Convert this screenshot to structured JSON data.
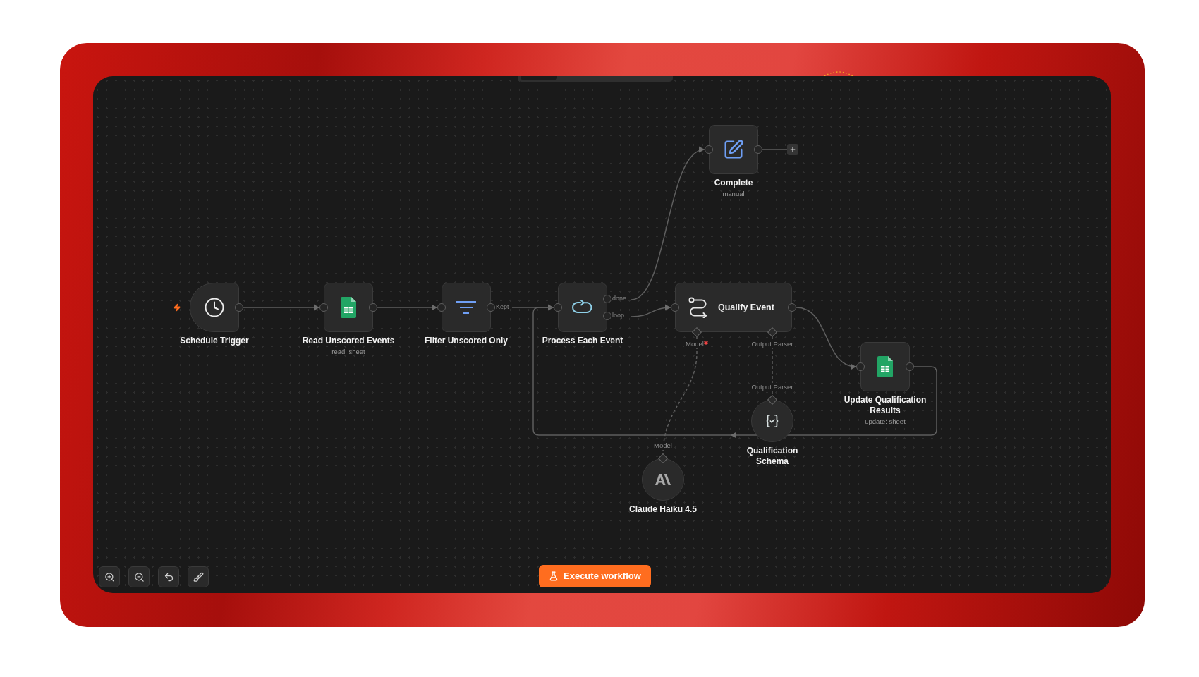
{
  "canvas": {
    "nodes": [
      {
        "kind": "trigger",
        "label": "Schedule Trigger"
      },
      {
        "kind": "action",
        "label": "Read Unscored Events",
        "subtitle": "read: sheet"
      },
      {
        "kind": "action",
        "label": "Filter Unscored Only",
        "outputs": [
          "Kept"
        ]
      },
      {
        "kind": "action",
        "label": "Process Each Event",
        "outputs": [
          "done",
          "loop"
        ]
      },
      {
        "kind": "action",
        "label": "Complete",
        "subtitle": "manual"
      },
      {
        "kind": "agent",
        "label": "Qualify Event",
        "inputs": [
          {
            "label": "Model",
            "required": true
          },
          {
            "label": "Output Parser",
            "required": false
          }
        ]
      },
      {
        "kind": "action",
        "label": "Update Qualification Results",
        "subtitle": "update: sheet"
      },
      {
        "kind": "subnode",
        "label": "Qualification Schema",
        "port": "Output Parser"
      },
      {
        "kind": "subnode",
        "label": "Claude Haiku 4.5",
        "port": "Model"
      }
    ]
  },
  "execute_button": {
    "label": "Execute workflow"
  }
}
